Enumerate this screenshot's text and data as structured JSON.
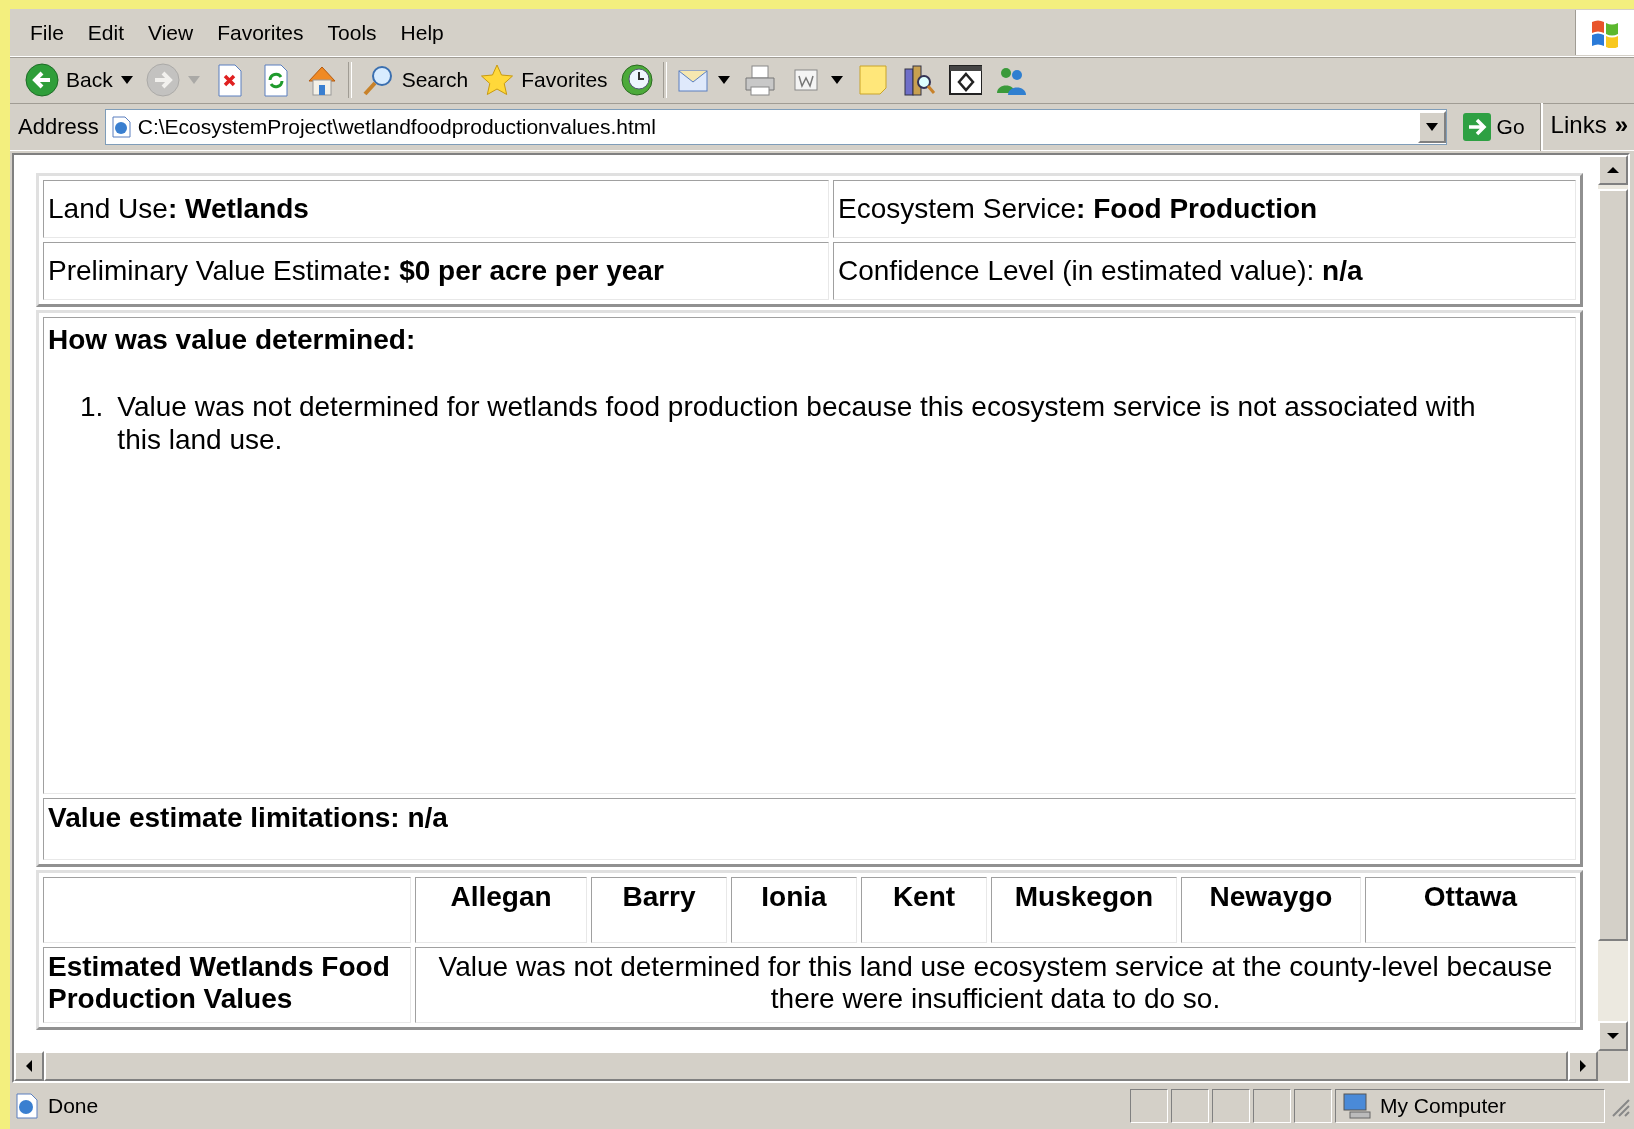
{
  "menu": [
    "File",
    "Edit",
    "View",
    "Favorites",
    "Tools",
    "Help"
  ],
  "toolbar": {
    "groups": [
      {
        "buttons": [
          {
            "kind": "back",
            "label": "Back",
            "dropdown": true,
            "disabled": false
          },
          {
            "kind": "forward",
            "dropdown": true,
            "disabled": true
          },
          {
            "kind": "stop",
            "dropdown": false,
            "disabled": false
          },
          {
            "kind": "refresh",
            "dropdown": false,
            "disabled": false
          },
          {
            "kind": "home",
            "dropdown": false,
            "disabled": false
          }
        ]
      },
      {
        "buttons": [
          {
            "kind": "search",
            "label": "Search",
            "dropdown": false,
            "disabled": false
          },
          {
            "kind": "favorites",
            "label": "Favorites",
            "dropdown": false,
            "disabled": false
          },
          {
            "kind": "history",
            "dropdown": false,
            "disabled": false
          }
        ]
      },
      {
        "buttons": [
          {
            "kind": "mail",
            "dropdown": true,
            "disabled": false
          },
          {
            "kind": "print",
            "dropdown": false,
            "disabled": false
          },
          {
            "kind": "edit",
            "dropdown": true,
            "disabled": false
          },
          {
            "kind": "note",
            "dropdown": false,
            "disabled": false
          },
          {
            "kind": "research",
            "dropdown": false,
            "disabled": false
          },
          {
            "kind": "window",
            "dropdown": false,
            "disabled": false
          },
          {
            "kind": "people",
            "dropdown": false,
            "disabled": false
          }
        ]
      }
    ]
  },
  "address": {
    "label": "Address",
    "value": "C:\\EcosystemProject\\wetlandfoodproductionvalues.html",
    "go": "Go",
    "links": "Links",
    "more": "»"
  },
  "page": {
    "summary": [
      [
        "Land Use**: Wetlands**",
        "Ecosystem Service**: Food Production**"
      ],
      [
        "Preliminary Value Estimate**: $0 per acre per year**",
        "Confidence Level (in estimated value): **n/a**"
      ]
    ],
    "method": {
      "heading": "How was value determined:",
      "items": [
        {
          "number": "1.",
          "text": "Value was not determined for wetlands food production because this ecosystem service is not associated with this land use."
        }
      ]
    },
    "limitations": "Value estimate limitations: n/a",
    "counties": {
      "columns": [
        "Allegan",
        "Barry",
        "Ionia",
        "Kent",
        "Muskegon",
        "Newaygo",
        "Ottawa"
      ],
      "row_label": "Estimated Wetlands Food Production Values",
      "note": "Value was not determined for this land use ecosystem service at the county-level because there were insufficient data to do so."
    }
  },
  "status_bar": {
    "text": "Done",
    "zone": "My Computer"
  }
}
